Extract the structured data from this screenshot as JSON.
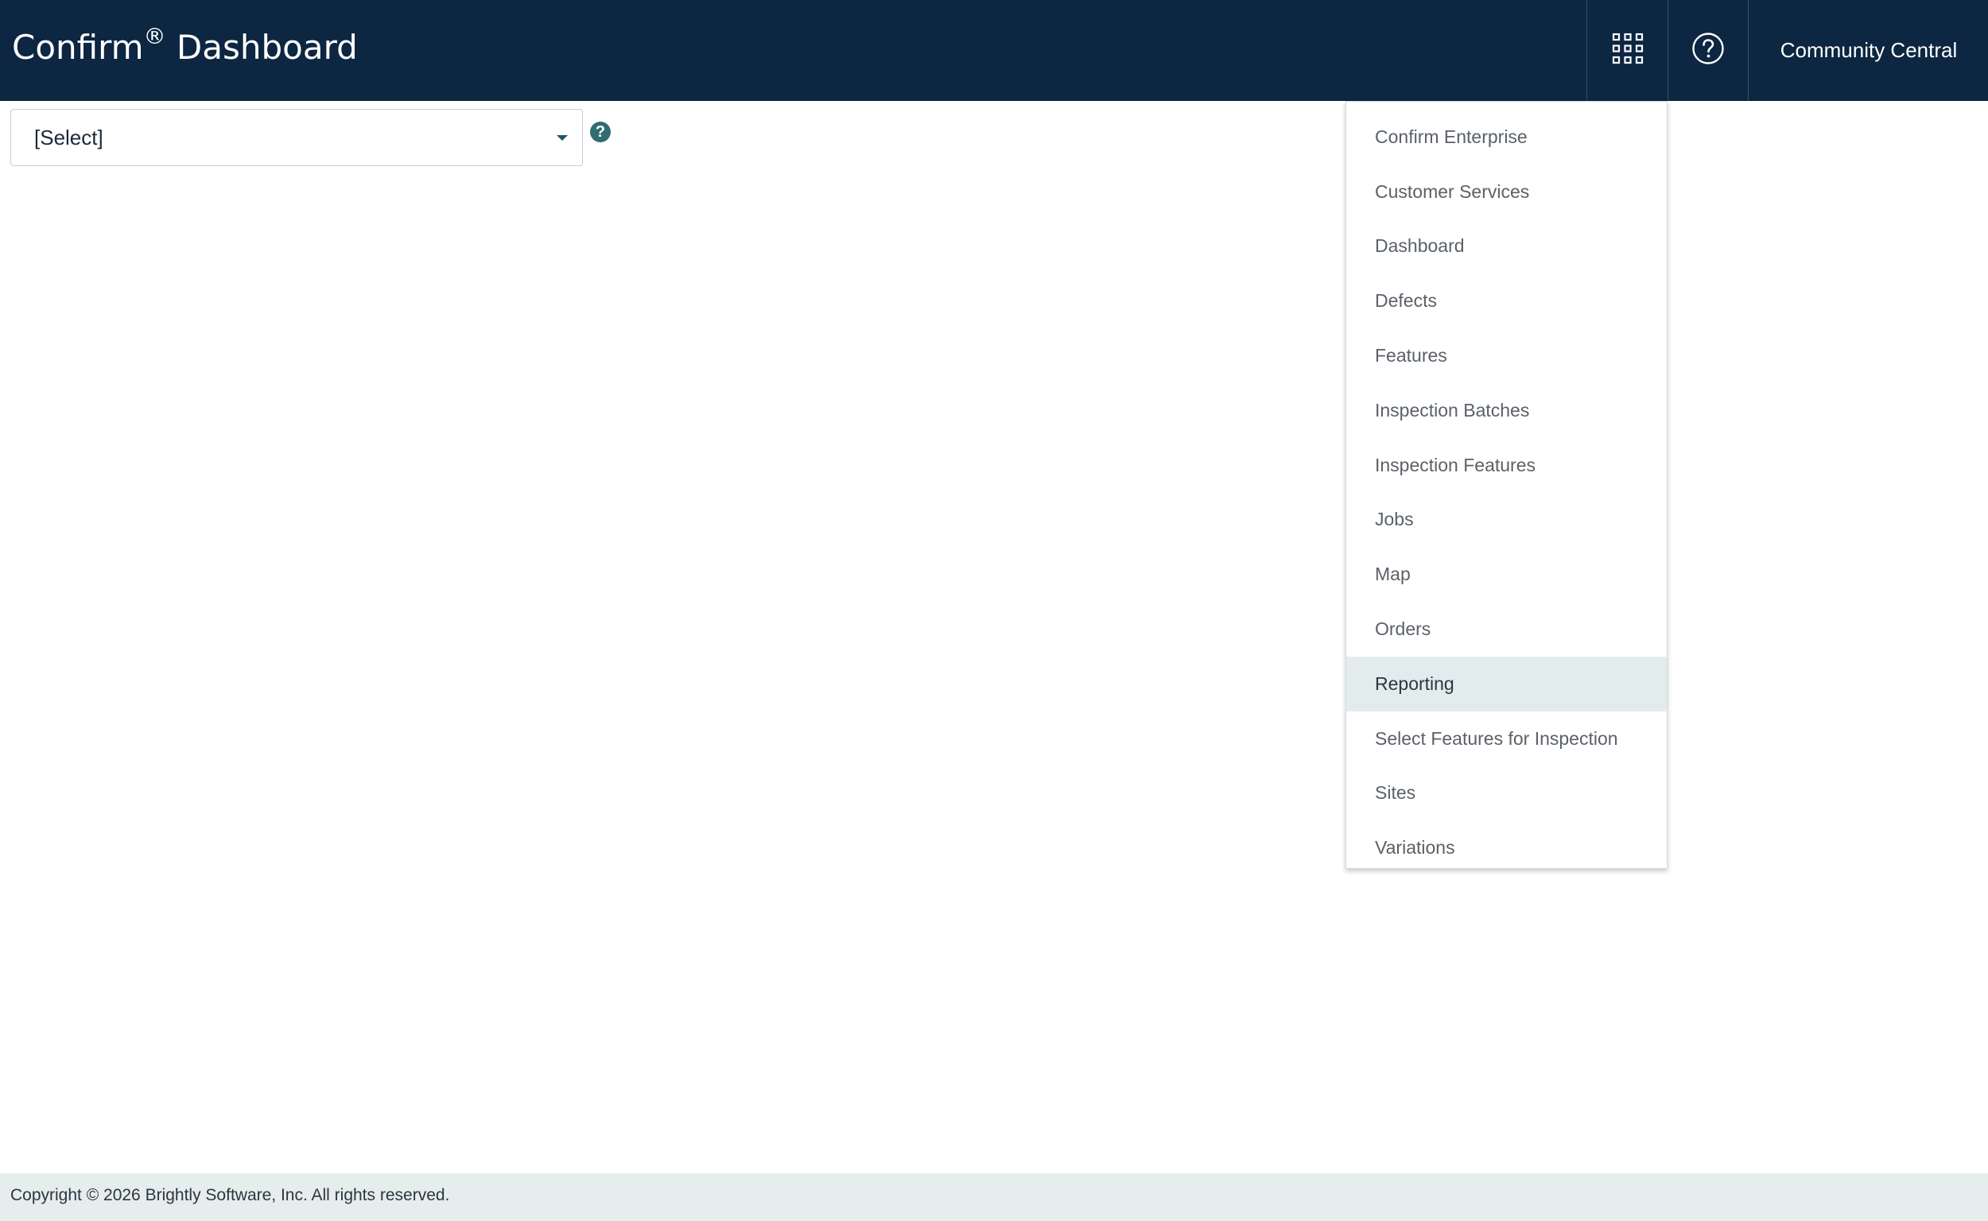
{
  "header": {
    "title_main": "Confirm",
    "title_reg": "®",
    "title_rest": " Dashboard",
    "apps_icon": "grid-icon",
    "help_icon": "help-circle-icon",
    "user_label": "Community Central"
  },
  "selector": {
    "value": "[Select]",
    "help_icon": "question-icon",
    "help_glyph": "?"
  },
  "apps_menu": {
    "items": [
      {
        "label": "Confirm Enterprise"
      },
      {
        "label": "Customer Services"
      },
      {
        "label": "Dashboard"
      },
      {
        "label": "Defects"
      },
      {
        "label": "Features"
      },
      {
        "label": "Inspection Batches"
      },
      {
        "label": "Inspection Features"
      },
      {
        "label": "Jobs"
      },
      {
        "label": "Map"
      },
      {
        "label": "Orders"
      },
      {
        "label": "Reporting"
      },
      {
        "label": "Select Features for Inspection"
      },
      {
        "label": "Sites"
      },
      {
        "label": "Variations"
      }
    ],
    "highlighted": "Reporting"
  },
  "footer": {
    "copyright": "Copyright © 2026 Brightly Software, Inc. All rights reserved."
  },
  "colors": {
    "header_bg": "#0d2641",
    "accent": "#2f6d70",
    "menu_highlight": "#e3ecec",
    "footer_bg": "#e5eded"
  }
}
